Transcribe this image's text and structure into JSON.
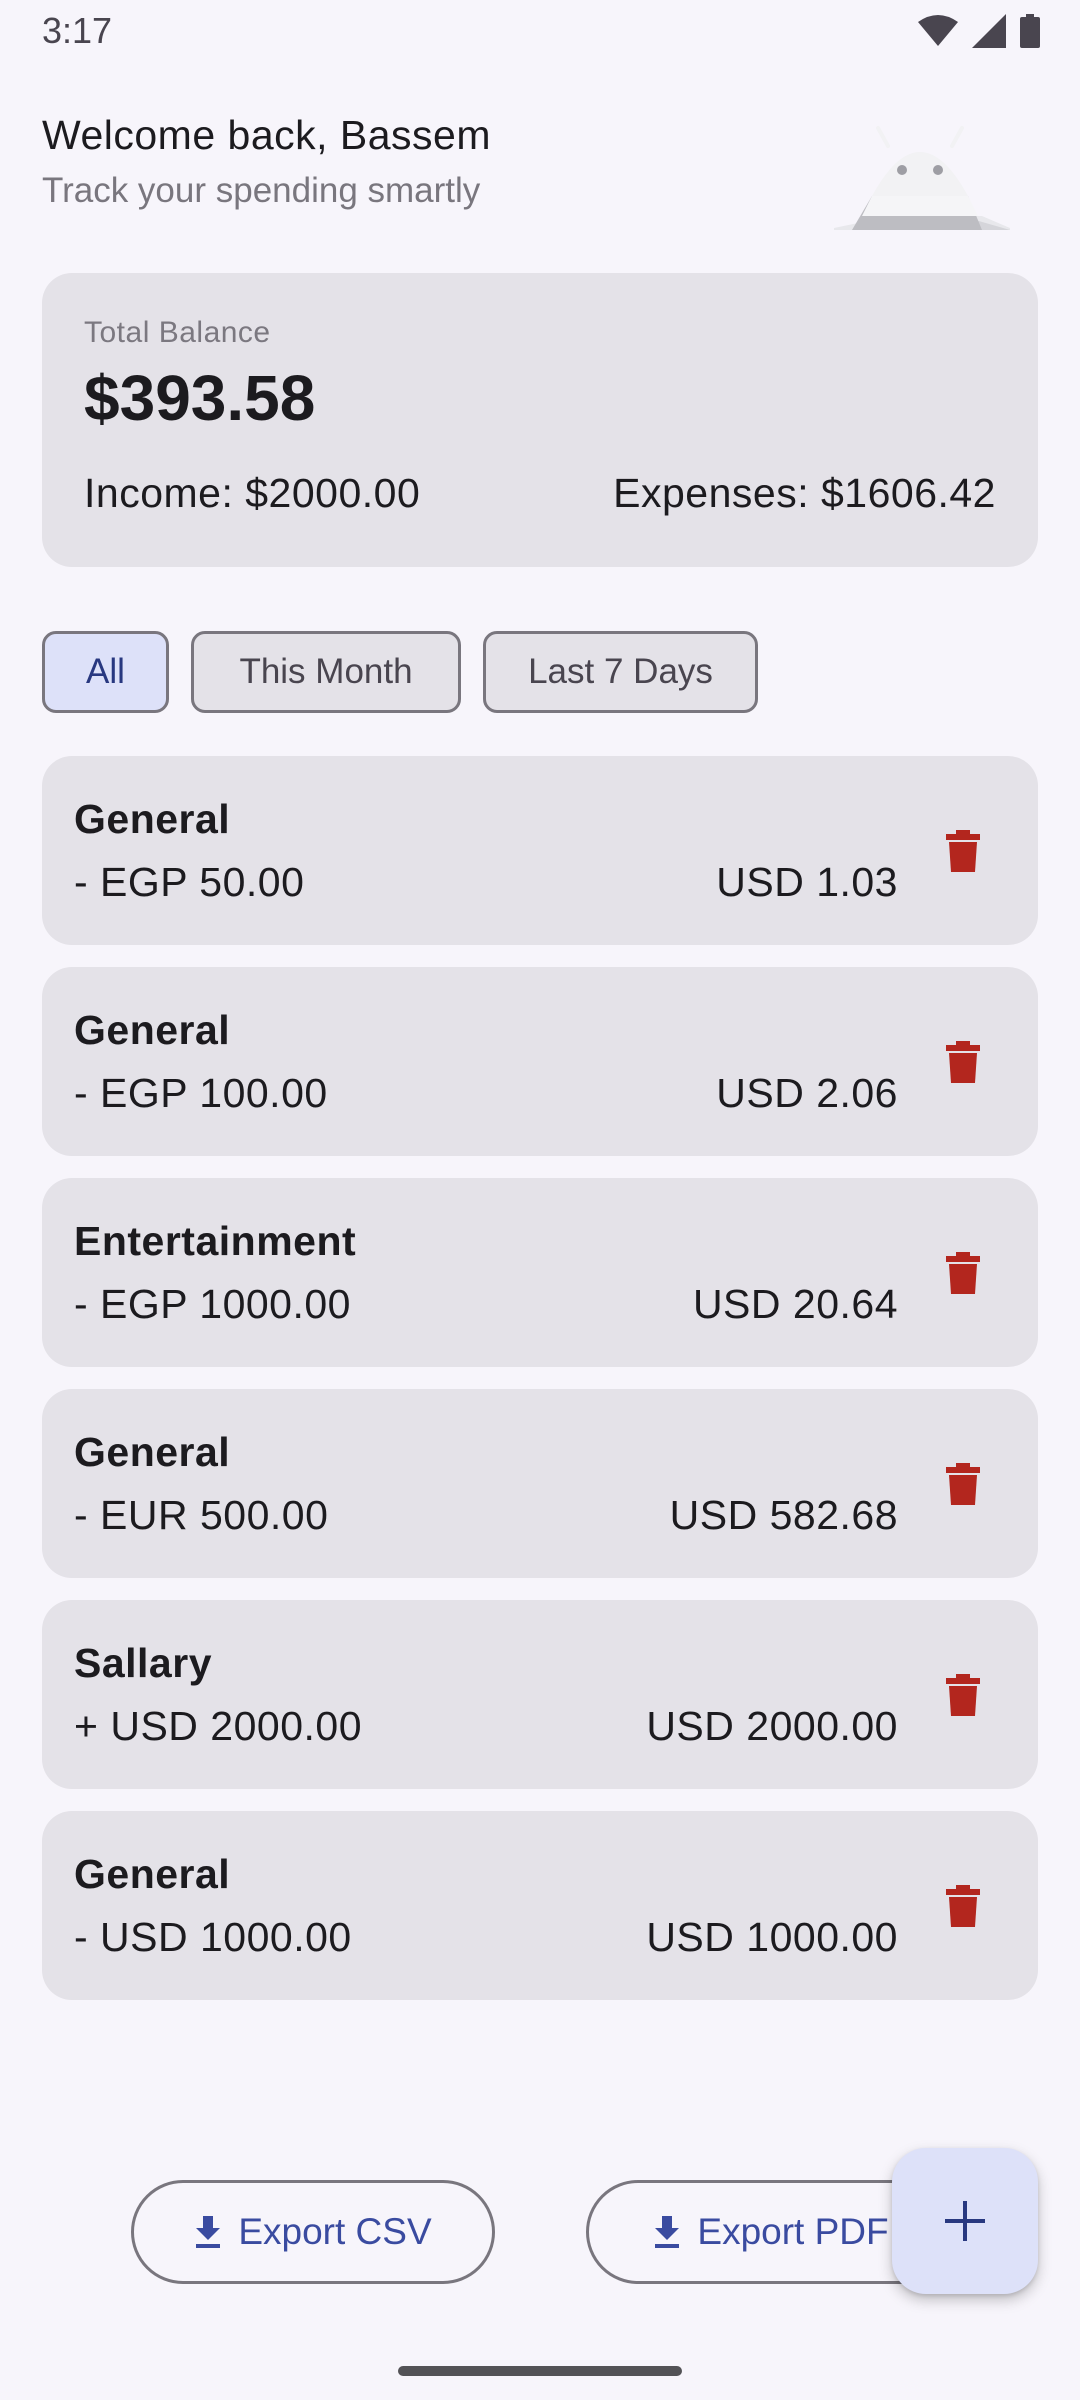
{
  "status_bar": {
    "time": "3:17"
  },
  "header": {
    "welcome": "Welcome back, Bassem",
    "subtitle": "Track your spending smartly"
  },
  "balance": {
    "label": "Total Balance",
    "amount": "$393.58",
    "income": "Income: $2000.00",
    "expenses": "Expenses: $1606.42"
  },
  "filters": [
    {
      "label": "All",
      "selected": true
    },
    {
      "label": "This Month",
      "selected": false
    },
    {
      "label": "Last 7 Days",
      "selected": false
    }
  ],
  "transactions": [
    {
      "category": "General",
      "amount": "- EGP 50.00",
      "converted": "USD 1.03"
    },
    {
      "category": "General",
      "amount": "- EGP 100.00",
      "converted": "USD 2.06"
    },
    {
      "category": "Entertainment",
      "amount": "- EGP 1000.00",
      "converted": "USD 20.64"
    },
    {
      "category": "General",
      "amount": "- EUR 500.00",
      "converted": "USD 582.68"
    },
    {
      "category": "Sallary",
      "amount": "+ USD 2000.00",
      "converted": "USD 2000.00"
    },
    {
      "category": "General",
      "amount": "- USD 1000.00",
      "converted": "USD 1000.00"
    }
  ],
  "actions": {
    "export_csv": "Export CSV",
    "export_pdf": "Export PDF"
  },
  "icons": {
    "delete": "trash-icon",
    "download": "download-icon",
    "add": "plus-icon",
    "wifi": "wifi-icon",
    "signal": "signal-icon",
    "battery": "battery-icon"
  },
  "colors": {
    "delete_red": "#B3261E",
    "accent": "#3A4BA0",
    "chip_selected": "#DDE1F9",
    "card": "#E4E2E8"
  }
}
